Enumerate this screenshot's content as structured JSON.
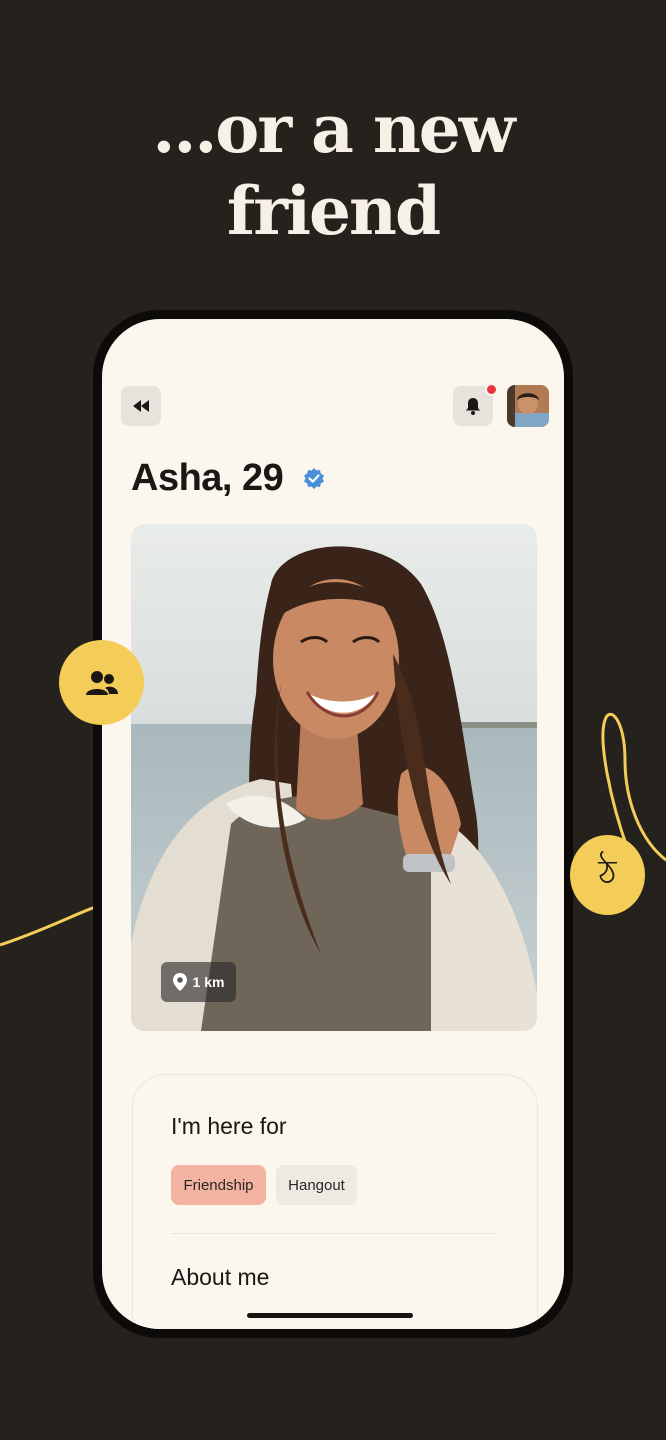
{
  "headline": {
    "line1": "...or a new",
    "line2": "friend"
  },
  "profile": {
    "name_age": "Asha, 29",
    "verified_icon": "verified-badge-icon",
    "distance": "1 km"
  },
  "header": {
    "back_icon": "rewind-icon",
    "bell_icon": "bell-icon",
    "has_notification": true
  },
  "card": {
    "here_for_heading": "I'm here for",
    "chips": [
      "Friendship",
      "Hangout"
    ],
    "about_heading": "About me"
  },
  "decor": {
    "friends_badge_icon": "people-icon",
    "letter_badge": "ঠ"
  },
  "colors": {
    "background": "#25211c",
    "accent_yellow": "#f4cc58",
    "chip_selected": "#f2b3a0",
    "screen": "#fbf7ef",
    "verified_blue": "#4a90d9"
  }
}
